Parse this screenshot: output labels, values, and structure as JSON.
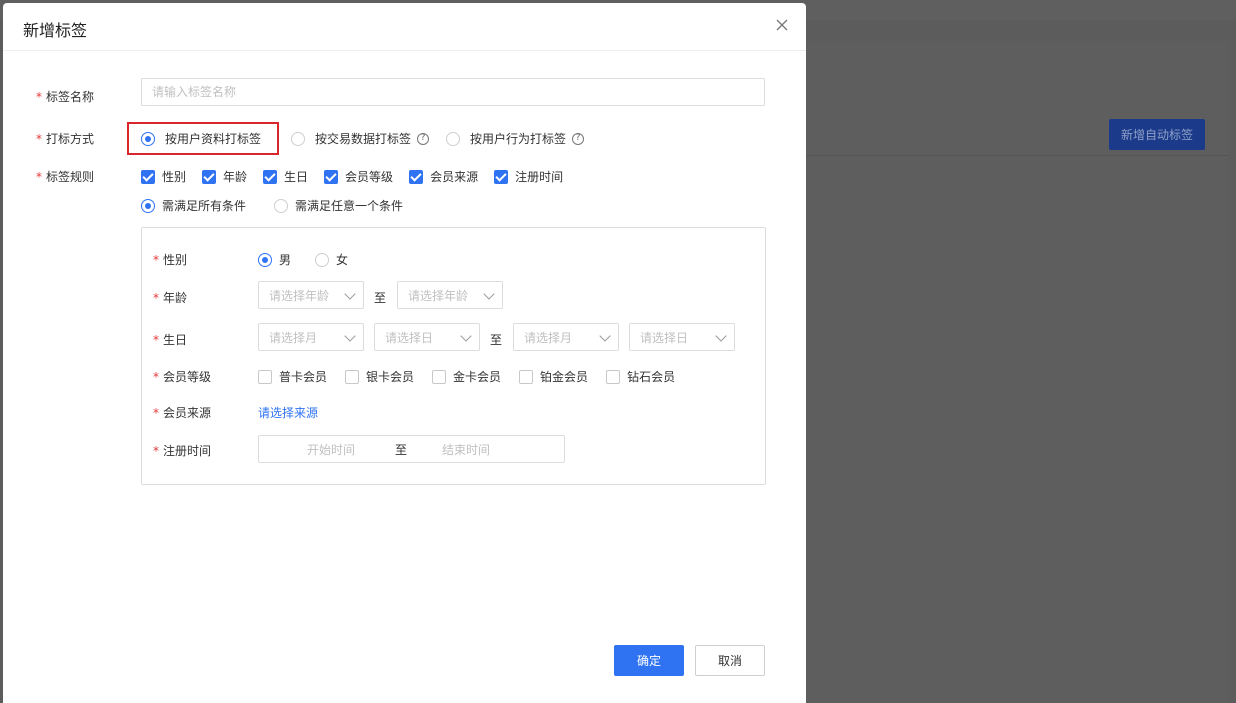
{
  "background": {
    "button_label": "新增自动标签"
  },
  "dialog": {
    "title": "新增标签",
    "close_icon": "close-icon",
    "fields": {
      "tag_name": {
        "label": "标签名称",
        "placeholder": "请输入标签名称",
        "value": ""
      },
      "tag_method": {
        "label": "打标方式",
        "options": [
          {
            "label": "按用户资料打标签",
            "selected": true
          },
          {
            "label": "按交易数据打标签",
            "selected": false,
            "help_icon": "question-circle-icon"
          },
          {
            "label": "按用户行为打标签",
            "selected": false,
            "help_icon": "question-circle-icon"
          }
        ]
      },
      "tag_rules": {
        "label": "标签规则",
        "checkboxes": [
          {
            "label": "性别",
            "checked": true
          },
          {
            "label": "年龄",
            "checked": true
          },
          {
            "label": "生日",
            "checked": true
          },
          {
            "label": "会员等级",
            "checked": true
          },
          {
            "label": "会员来源",
            "checked": true
          },
          {
            "label": "注册时间",
            "checked": true
          }
        ],
        "match_options": [
          {
            "label": "需满足所有条件",
            "selected": true
          },
          {
            "label": "需满足任意一个条件",
            "selected": false
          }
        ]
      }
    },
    "conditions": {
      "gender": {
        "label": "性别",
        "options": [
          {
            "label": "男",
            "selected": true
          },
          {
            "label": "女",
            "selected": false
          }
        ]
      },
      "age": {
        "label": "年龄",
        "from_placeholder": "请选择年龄",
        "to_placeholder": "请选择年龄",
        "separator": "至"
      },
      "birthday": {
        "label": "生日",
        "from_month": "请选择月",
        "from_day": "请选择日",
        "to_month": "请选择月",
        "to_day": "请选择日",
        "separator": "至"
      },
      "member_level": {
        "label": "会员等级",
        "options": [
          {
            "label": "普卡会员",
            "checked": false
          },
          {
            "label": "银卡会员",
            "checked": false
          },
          {
            "label": "金卡会员",
            "checked": false
          },
          {
            "label": "铂金会员",
            "checked": false
          },
          {
            "label": "钻石会员",
            "checked": false
          }
        ]
      },
      "member_source": {
        "label": "会员来源",
        "link": "请选择来源"
      },
      "register_time": {
        "label": "注册时间",
        "start_placeholder": "开始时间",
        "separator": "至",
        "end_placeholder": "结束时间"
      }
    },
    "footer": {
      "confirm": "确定",
      "cancel": "取消"
    }
  },
  "colors": {
    "primary": "#2f73f2",
    "required": "#e4393c",
    "highlight_border": "#d8262c"
  }
}
